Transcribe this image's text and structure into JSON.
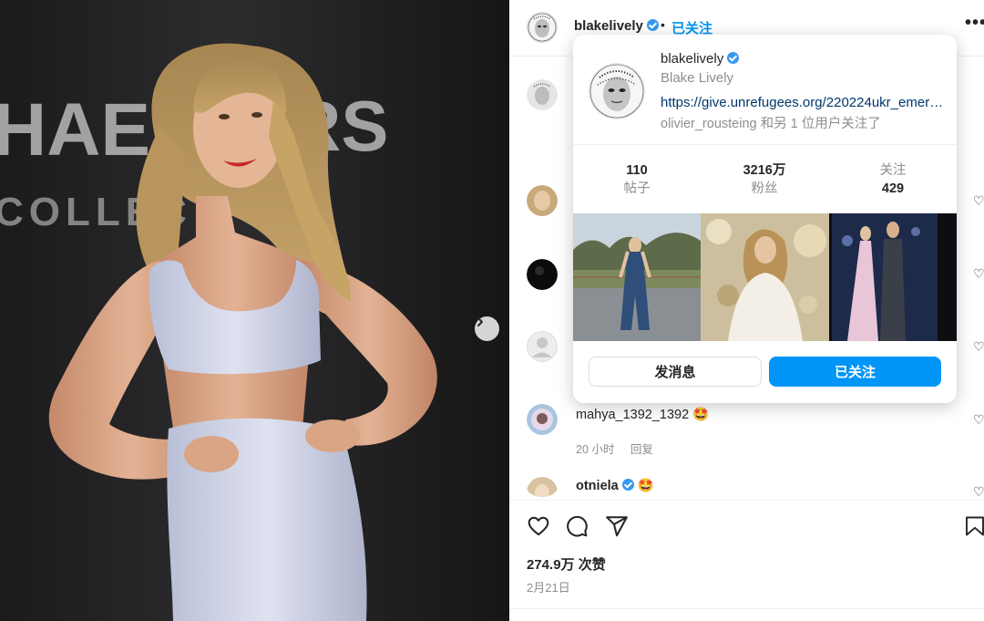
{
  "post": {
    "author": "blakelively",
    "header_follow_label": "已关注",
    "header_separator": "•",
    "more_label": "•••"
  },
  "hover_card": {
    "username": "blakelively",
    "full_name": "Blake Lively",
    "link": "https://give.unrefugees.org/220224ukr_emer…",
    "followed_by": "olivier_rousteing 和另 1 位用户关注了",
    "stats": [
      {
        "number": "110",
        "label": "帖子"
      },
      {
        "number": "3216万",
        "label": "粉丝"
      },
      {
        "number": "429",
        "label": "关注"
      }
    ],
    "message_button": "发消息",
    "following_button": "已关注"
  },
  "backdrop_text": {
    "line1": "HAEL",
    "line1b": "RS",
    "line2": "COLLEC"
  },
  "comments": [
    {
      "username": "mahya_1392_1392",
      "emoji": "🤩",
      "time": "20 小时",
      "reply": "回复"
    },
    {
      "username": "otniela",
      "emoji": "🤩"
    }
  ],
  "likes": {
    "count": "274.9万",
    "label": "次赞"
  },
  "date": "2月21日",
  "colors": {
    "accent": "#0095f6",
    "link": "#00376b",
    "verified": "#3897f0"
  }
}
